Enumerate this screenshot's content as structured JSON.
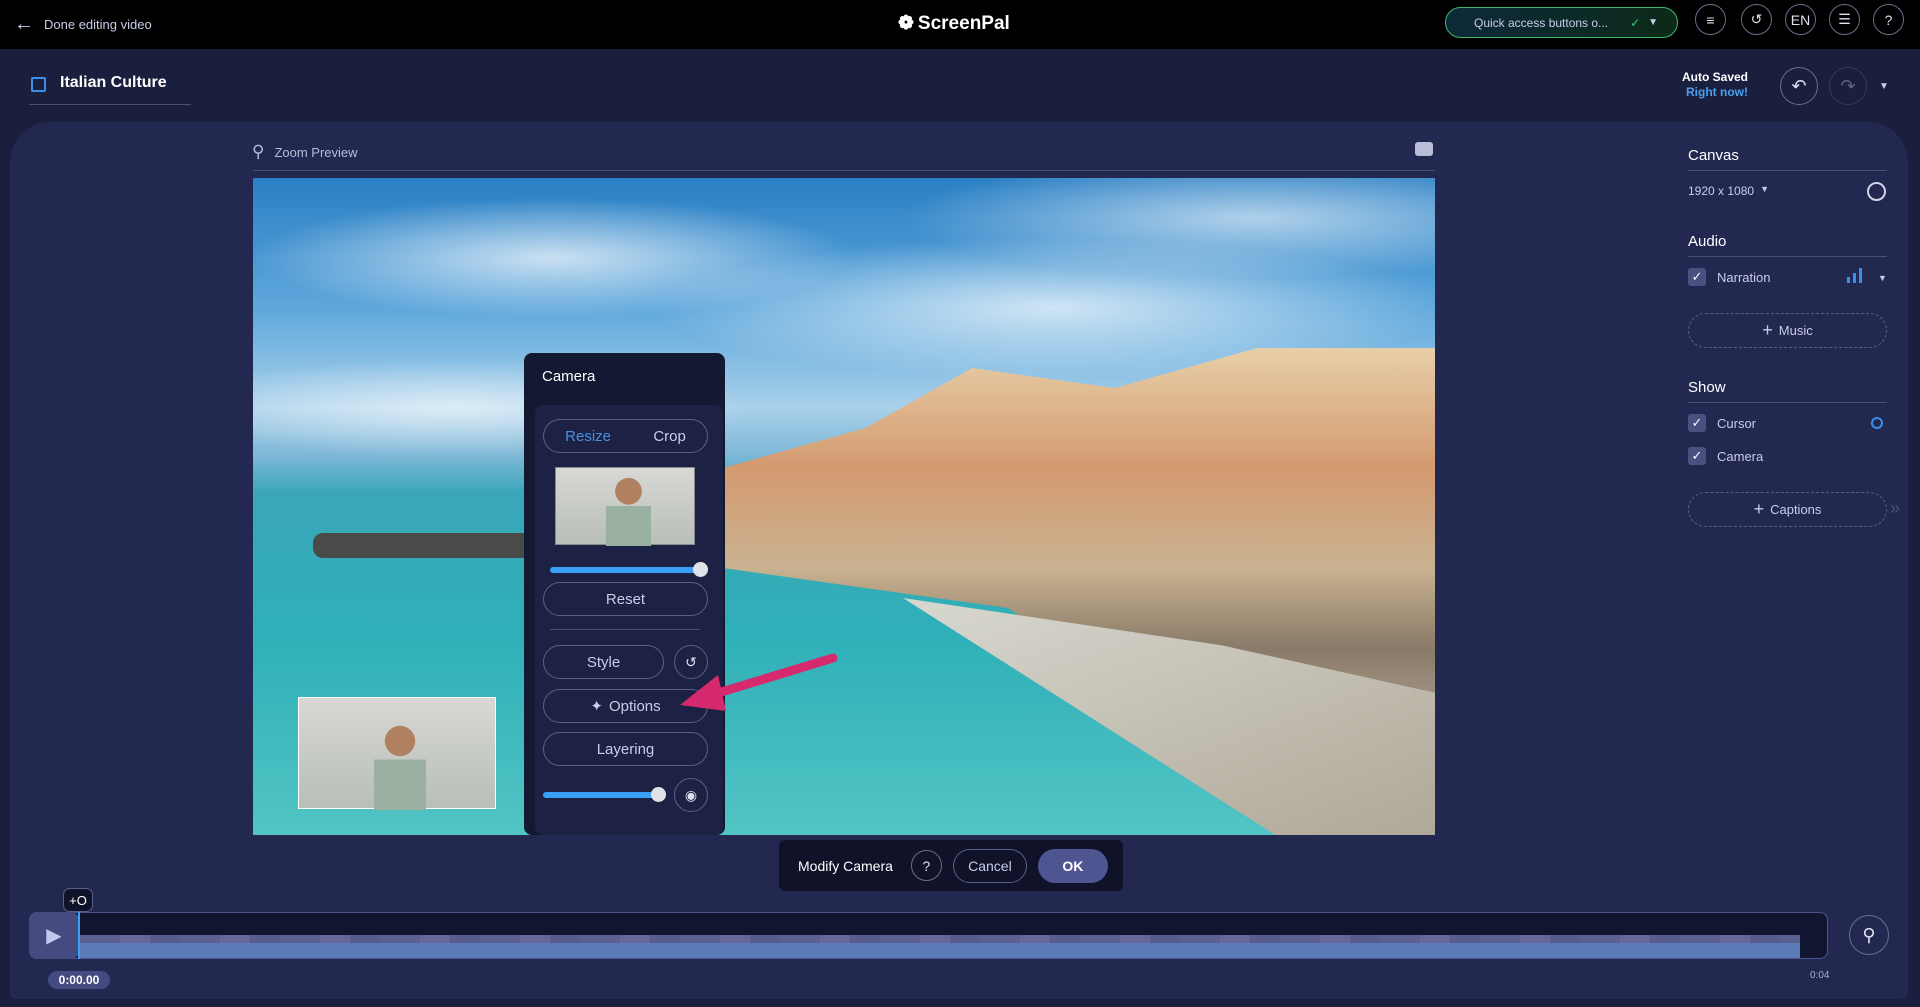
{
  "topbar": {
    "back_label": "Done editing video",
    "logo": "ScreenPal",
    "quick_access": "Quick access buttons o...",
    "lang": "EN"
  },
  "project": {
    "title": "Italian Culture",
    "autosave_label": "Auto Saved",
    "autosave_time": "Right now!"
  },
  "preview": {
    "zoom_label": "Zoom Preview"
  },
  "camera_panel": {
    "title": "Camera",
    "tab_resize": "Resize",
    "tab_crop": "Crop",
    "active_tab": "Resize",
    "size_slider": 1.0,
    "reset": "Reset",
    "style": "Style",
    "options": "Options",
    "layering": "Layering",
    "opacity_slider": 0.9
  },
  "modify_bar": {
    "label": "Modify Camera",
    "help": "?",
    "cancel": "Cancel",
    "ok": "OK"
  },
  "timeline": {
    "marker": "+O",
    "current_time": "0:00.00",
    "end_time": "0:04"
  },
  "sidebar": {
    "canvas": {
      "title": "Canvas",
      "size": "1920 x 1080"
    },
    "audio": {
      "title": "Audio",
      "narration": "Narration",
      "narration_checked": true,
      "music": "Music"
    },
    "show": {
      "title": "Show",
      "cursor": "Cursor",
      "cursor_checked": true,
      "camera": "Camera",
      "camera_checked": true,
      "captions": "Captions"
    }
  },
  "colors": {
    "accent": "#4a90e2",
    "highlight_arrow": "#d6296e",
    "ok_button": "#4f5590",
    "slider": "#3aa0f5"
  }
}
